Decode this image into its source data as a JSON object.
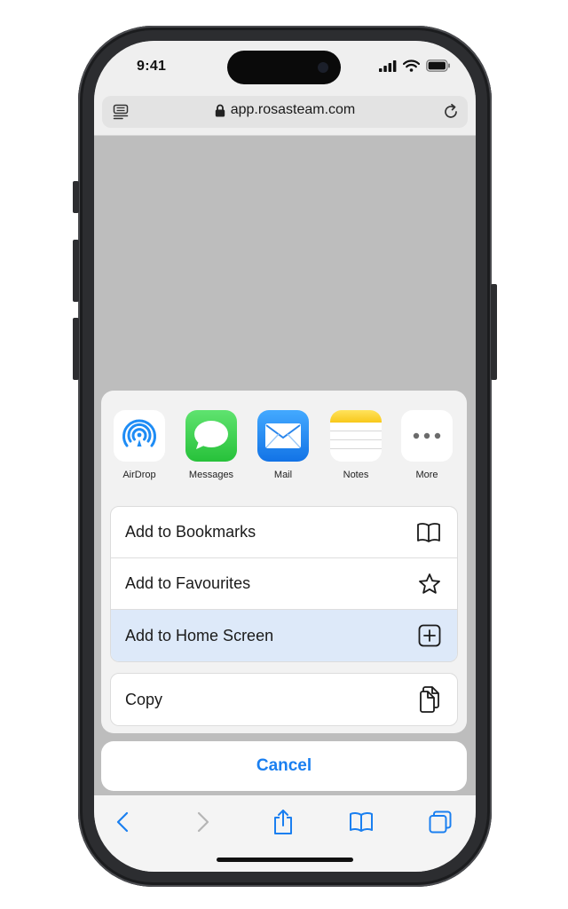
{
  "status_bar": {
    "time": "9:41"
  },
  "address_bar": {
    "url": "app.rosasteam.com"
  },
  "share_apps": [
    {
      "label": "AirDrop",
      "icon": "airdrop-icon"
    },
    {
      "label": "Messages",
      "icon": "messages-icon"
    },
    {
      "label": "Mail",
      "icon": "mail-icon"
    },
    {
      "label": "Notes",
      "icon": "notes-icon"
    },
    {
      "label": "More",
      "icon": "more-icon"
    }
  ],
  "actions": {
    "bookmarks": {
      "label": "Add to Bookmarks",
      "icon": "book-icon"
    },
    "favourites": {
      "label": "Add to Favourites",
      "icon": "star-icon"
    },
    "home_screen": {
      "label": "Add to Home Screen",
      "icon": "plus-square-icon"
    },
    "copy": {
      "label": "Copy",
      "icon": "copy-icon"
    }
  },
  "cancel": {
    "label": "Cancel"
  },
  "colors": {
    "accent": "#1a7ff0",
    "highlight": "#dde9f9",
    "messages_green": "#34c759",
    "mail_blue": "#1e8cf5",
    "notes_yellow": "#ffd52e"
  }
}
